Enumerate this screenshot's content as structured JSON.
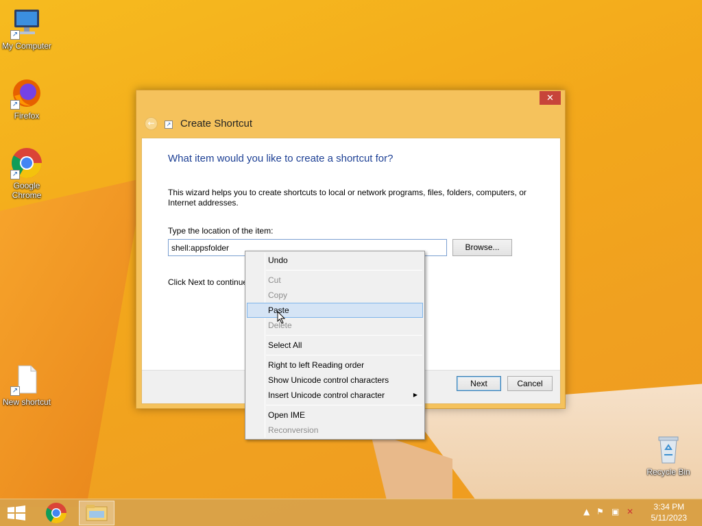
{
  "desktop": {
    "icons": [
      {
        "label": "My Computer",
        "icon": "computer-icon"
      },
      {
        "label": "Firefox",
        "icon": "firefox-icon"
      },
      {
        "label": "Google Chrome",
        "icon": "chrome-icon"
      },
      {
        "label": "New shortcut",
        "icon": "document-icon"
      },
      {
        "label": "Recycle Bin",
        "icon": "recycle-bin-icon"
      }
    ]
  },
  "dialog": {
    "title": "Create Shortcut",
    "close_label": "✕",
    "heading": "What item would you like to create a shortcut for?",
    "description": "This wizard helps you to create shortcuts to local or network programs, files, folders, computers, or Internet addresses.",
    "location_label": "Type the location of the item:",
    "location_value": "shell:appsfolder",
    "browse_label": "Browse...",
    "next_hint": "Click Next to continue.",
    "next_label": "Next",
    "cancel_label": "Cancel"
  },
  "context_menu": {
    "items": [
      {
        "label": "Undo",
        "enabled": true
      },
      {
        "label": "Cut",
        "enabled": false
      },
      {
        "label": "Copy",
        "enabled": false
      },
      {
        "label": "Paste",
        "enabled": true,
        "highlighted": true
      },
      {
        "label": "Delete",
        "enabled": false
      },
      {
        "label": "Select All",
        "enabled": true
      },
      {
        "label": "Right to left Reading order",
        "enabled": true
      },
      {
        "label": "Show Unicode control characters",
        "enabled": true
      },
      {
        "label": "Insert Unicode control character",
        "enabled": true,
        "submenu": true
      },
      {
        "label": "Open IME",
        "enabled": true
      },
      {
        "label": "Reconversion",
        "enabled": false
      }
    ]
  },
  "taskbar": {
    "time": "3:34 PM",
    "date": "5/11/2023",
    "colors": {
      "accent": "#f3a81b",
      "taskbar": "#d8a24b"
    }
  }
}
